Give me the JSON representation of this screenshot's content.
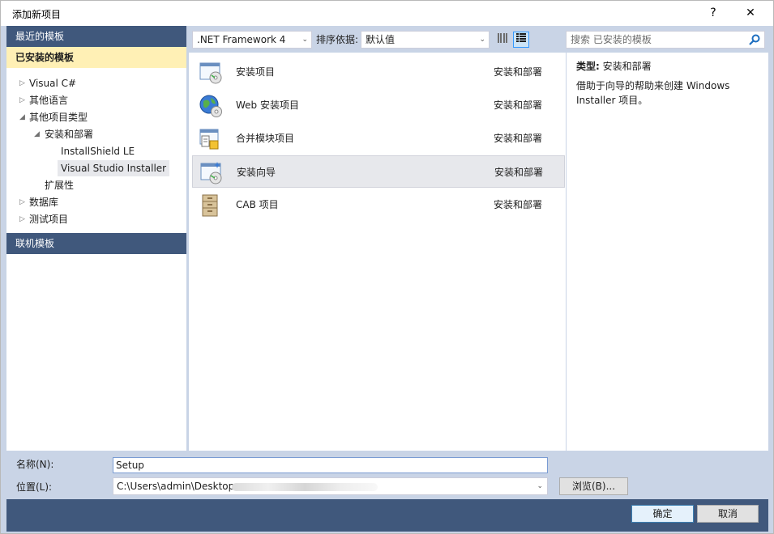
{
  "window": {
    "title": "添加新项目",
    "help_glyph": "?",
    "close_glyph": "✕"
  },
  "left": {
    "recent": "最近的模板",
    "installed": "已安装的模板",
    "online": "联机模板",
    "tree": [
      {
        "label": "Visual C#",
        "arrow": "▷"
      },
      {
        "label": "其他语言",
        "arrow": "▷"
      },
      {
        "label": "其他项目类型",
        "arrow": "◢"
      },
      {
        "label": "安装和部署",
        "arrow": "◢"
      },
      {
        "label": "InstallShield LE",
        "arrow": ""
      },
      {
        "label": "Visual Studio Installer",
        "arrow": ""
      },
      {
        "label": "扩展性",
        "arrow": ""
      },
      {
        "label": "数据库",
        "arrow": "▷"
      },
      {
        "label": "测试项目",
        "arrow": "▷"
      }
    ]
  },
  "toolbar": {
    "framework": ".NET Framework 4",
    "sort_label": "排序依据:",
    "sort_value": "默认值",
    "caret": "⌄"
  },
  "search": {
    "placeholder": "搜索 已安装的模板"
  },
  "templates": [
    {
      "name": "安装项目",
      "category": "安装和部署",
      "icon": "setup-project-icon"
    },
    {
      "name": "Web 安装项目",
      "category": "安装和部署",
      "icon": "web-setup-project-icon"
    },
    {
      "name": "合并模块项目",
      "category": "安装和部署",
      "icon": "merge-module-project-icon"
    },
    {
      "name": "安装向导",
      "category": "安装和部署",
      "icon": "setup-wizard-icon"
    },
    {
      "name": "CAB 项目",
      "category": "安装和部署",
      "icon": "cab-project-icon"
    }
  ],
  "description": {
    "type_label": "类型:",
    "type_value": "安装和部署",
    "text": "借助于向导的帮助来创建 Windows Installer 项目。"
  },
  "form": {
    "name_label": "名称(N):",
    "name_value": "Setup",
    "location_label": "位置(L):",
    "location_value": "C:\\Users\\admin\\Desktop",
    "browse": "浏览(B)..."
  },
  "buttons": {
    "ok": "确定",
    "cancel": "取消"
  },
  "colors": {
    "header_blue": "#40587c",
    "selected_yellow": "#fff0b5",
    "frame": "#c9d4e6"
  }
}
